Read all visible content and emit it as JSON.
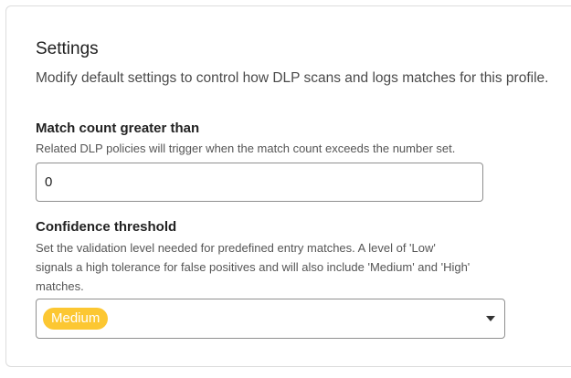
{
  "settings": {
    "title": "Settings",
    "description": "Modify default settings to control how DLP scans and logs matches for this profile."
  },
  "match_count": {
    "label": "Match count greater than",
    "help": "Related DLP policies will trigger when the match count exceeds the number set.",
    "value": "0"
  },
  "confidence": {
    "label": "Confidence threshold",
    "help_line1": "Set the validation level needed for predefined entry matches. A level of 'Low'",
    "help_line2": "signals a high tolerance for false positives and will also include 'Medium' and 'High'",
    "help_line3": "matches.",
    "selected": "Medium",
    "pill_color": "#fcc732",
    "dropdown_icon": "chevron-down-icon"
  }
}
